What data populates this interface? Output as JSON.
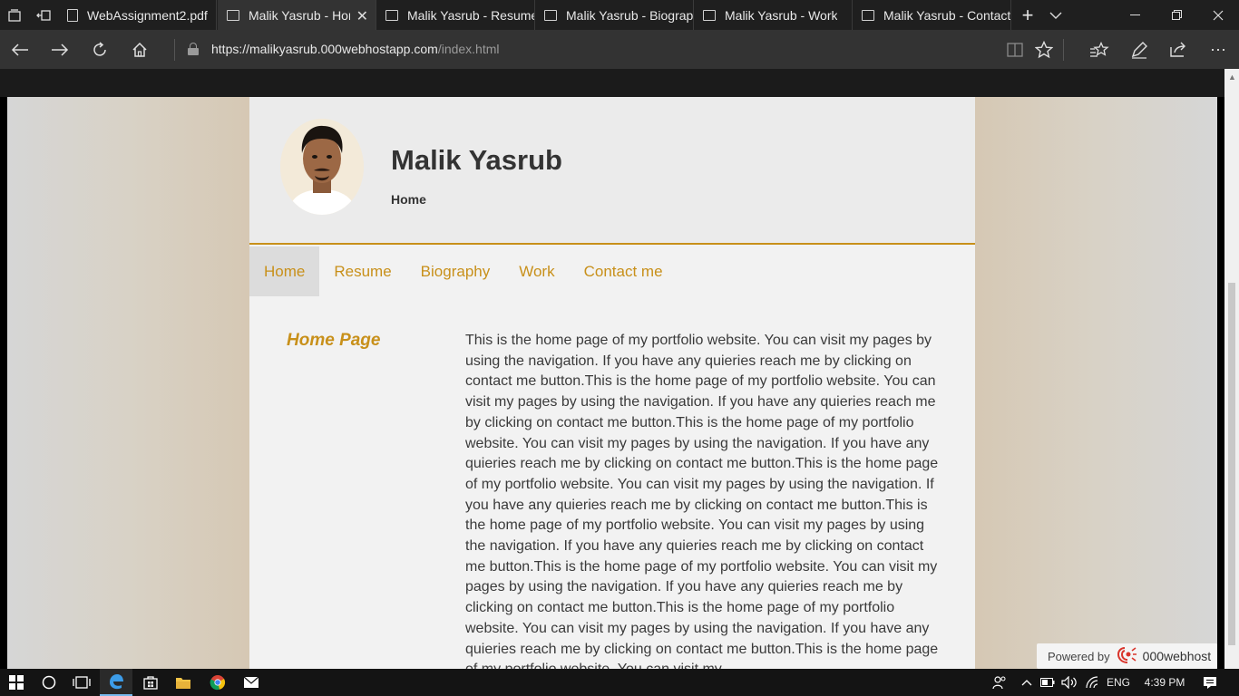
{
  "browser": {
    "tabs": [
      {
        "label": "WebAssignment2.pdf",
        "active": false
      },
      {
        "label": "Malik Yasrub - Hon",
        "active": true
      },
      {
        "label": "Malik Yasrub - Resume",
        "active": false
      },
      {
        "label": "Malik Yasrub - Biograpl",
        "active": false
      },
      {
        "label": "Malik Yasrub - Work",
        "active": false
      },
      {
        "label": "Malik Yasrub - Contact",
        "active": false
      }
    ],
    "url_host": "https://malikyasrub.000webhostapp.com",
    "url_path": "/index.html"
  },
  "site": {
    "name": "Malik Yasrub",
    "subtitle": "Home",
    "menu": [
      "Home",
      "Resume",
      "Biography",
      "Work",
      "Contact me"
    ],
    "section_title": "Home Page",
    "section_body": "This is the home page of my portfolio website. You can visit my pages by using the navigation. If you have any quieries reach me by clicking on contact me button.This is the home page of my portfolio website. You can visit my pages by using the navigation. If you have any quieries reach me by clicking on contact me button.This is the home page of my portfolio website. You can visit my pages by using the navigation. If you have any quieries reach me by clicking on contact me button.This is the home page of my portfolio website. You can visit my pages by using the navigation. If you have any quieries reach me by clicking on contact me button.This is the home page of my portfolio website. You can visit my pages by using the navigation. If you have any quieries reach me by clicking on contact me button.This is the home page of my portfolio website. You can visit my pages by using the navigation. If you have any quieries reach me by clicking on contact me button.This is the home page of my portfolio website. You can visit my pages by using the navigation. If you have any quieries reach me by clicking on contact me button.This is the home page of my portfolio website. You can visit my",
    "powered_label": "Powered by",
    "powered_brand": "000webhost"
  },
  "taskbar": {
    "lang": "ENG",
    "time": "4:39 PM"
  },
  "colors": {
    "accent": "#c8901a",
    "chrome_dark": "#333333",
    "tabbar": "#1f1f1f"
  },
  "icons": [
    "set-aside-tabs-icon",
    "restore-tabs-icon",
    "pdf-icon",
    "page-icon",
    "close-icon",
    "new-tab-icon",
    "chevron-down-icon",
    "minimize-icon",
    "maximize-icon",
    "back-icon",
    "forward-icon",
    "refresh-icon",
    "home-icon",
    "lock-icon",
    "reading-view-icon",
    "star-icon",
    "favorites-icon",
    "pen-icon",
    "share-icon",
    "more-icon",
    "windows-start-icon",
    "search-icon",
    "task-view-icon",
    "edge-icon",
    "store-icon",
    "file-explorer-icon",
    "chrome-icon",
    "mail-icon",
    "people-icon",
    "chevron-up-icon",
    "battery-icon",
    "volume-icon",
    "wifi-icon",
    "notification-icon"
  ]
}
